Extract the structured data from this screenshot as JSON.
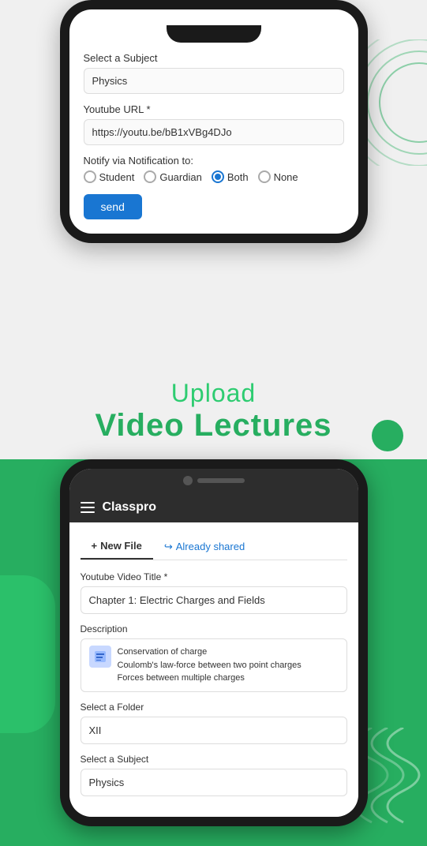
{
  "top_phone": {
    "subject_label": "Select a Subject",
    "subject_value": "Physics",
    "youtube_url_label": "Youtube URL *",
    "youtube_url_value": "https://youtu.be/bB1xVBg4DJo",
    "notify_label": "Notify via Notification to:",
    "radio_options": [
      "Student",
      "Guardian",
      "Both",
      "None"
    ],
    "radio_selected": "Both",
    "send_button": "send"
  },
  "banner": {
    "upload_text": "Upload",
    "video_lectures_text": "Video Lectures"
  },
  "bottom_phone": {
    "app_title": "Classpro",
    "tabs": [
      {
        "label": "+ New File",
        "active": true
      },
      {
        "label": "↪ Already shared",
        "active": false
      }
    ],
    "youtube_title_label": "Youtube Video Title *",
    "youtube_title_value": "Chapter 1: Electric Charges and Fields",
    "description_label": "Description",
    "description_lines": [
      "Conservation of charge",
      "Coulomb's law-force between two point charges",
      "Forces between multiple charges"
    ],
    "folder_label": "Select a Folder",
    "folder_value": "XII",
    "subject_label": "Select a Subject",
    "subject_value": "Physics"
  }
}
